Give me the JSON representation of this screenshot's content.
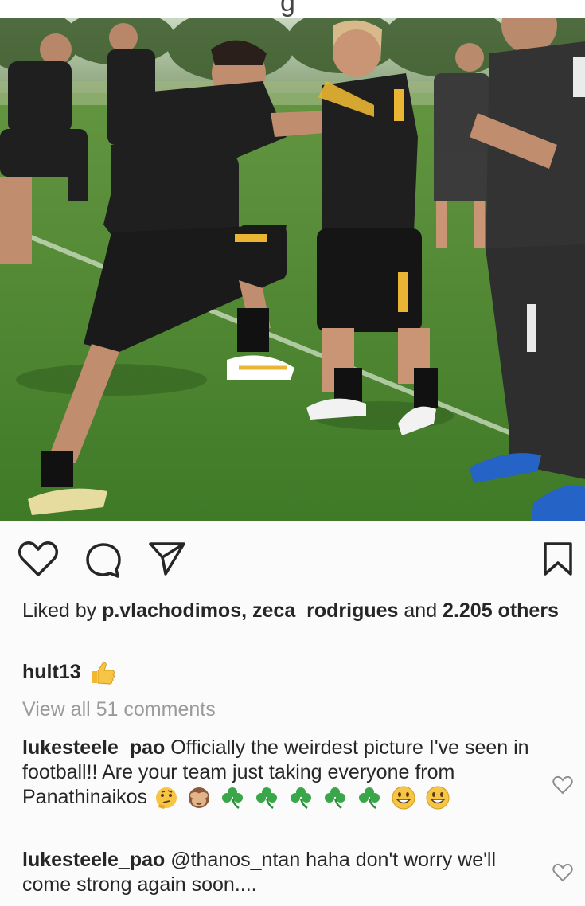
{
  "header": {
    "title_fragment": "g"
  },
  "post": {
    "photo_alt": "Football training session",
    "colors": {
      "grass": "#4e8a2f",
      "kit": "#1f1f1f",
      "accent": "#e9b532"
    }
  },
  "actions": {
    "like_icon": "heart-icon",
    "comment_icon": "comment-bubble-icon",
    "share_icon": "paper-plane-icon",
    "save_icon": "bookmark-icon"
  },
  "likes": {
    "prefix": "Liked by ",
    "user1": "p.vlachodimos",
    "separator": ", ",
    "user2": "zeca_rodrigues",
    "middle": " and ",
    "count": "2.205 others"
  },
  "caption": {
    "user": "hult13",
    "emoji": "thumbs-up-emoji"
  },
  "view_all": "View all 51 comments",
  "comments": [
    {
      "user": "lukesteele_pao",
      "text": "Officially the weirdest picture I've seen in football!! Are your team just taking everyone from Panathinaikos",
      "emojis": [
        "thinking-face-emoji",
        "see-no-evil-monkey-emoji",
        "shamrock-emoji",
        "shamrock-emoji",
        "shamrock-emoji",
        "shamrock-emoji",
        "shamrock-emoji",
        "grinning-face-emoji",
        "grinning-face-emoji"
      ]
    },
    {
      "user": "lukesteele_pao",
      "text": "@thanos_ntan haha don't worry we'll come strong again soon...."
    }
  ]
}
